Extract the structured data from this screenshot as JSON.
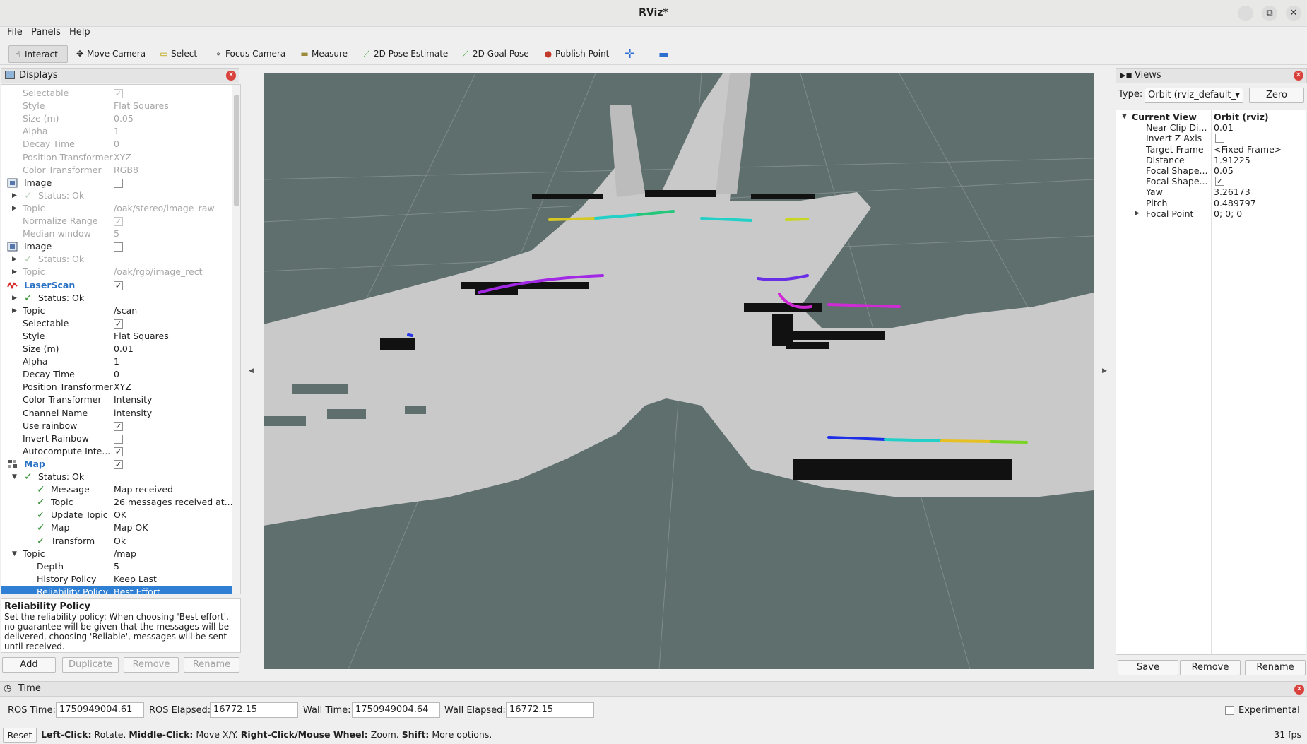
{
  "window": {
    "title": "RViz*"
  },
  "menu": [
    "File",
    "Panels",
    "Help"
  ],
  "toolbar": {
    "interact": "Interact",
    "move_camera": "Move Camera",
    "select": "Select",
    "focus_camera": "Focus Camera",
    "measure": "Measure",
    "pose_estimate": "2D Pose Estimate",
    "goal_pose": "2D Goal Pose",
    "publish_point": "Publish Point",
    "add_icon": "plus-icon",
    "remove_icon": "minus-icon"
  },
  "displays": {
    "title": "Displays",
    "rows": [
      {
        "label": "Selectable",
        "value": "",
        "checkbox": "on",
        "dim": true
      },
      {
        "label": "Style",
        "value": "Flat Squares",
        "dim": true
      },
      {
        "label": "Size (m)",
        "value": "0.05",
        "dim": true
      },
      {
        "label": "Alpha",
        "value": "1",
        "dim": true
      },
      {
        "label": "Decay Time",
        "value": "0",
        "dim": true
      },
      {
        "label": "Position Transformer",
        "value": "XYZ",
        "dim": true
      },
      {
        "label": "Color Transformer",
        "value": "RGB8",
        "dim": true
      },
      {
        "label": "Image",
        "value": "",
        "checkbox": "off",
        "icon": "image",
        "level": 0
      },
      {
        "label": "Status: Ok",
        "value": "",
        "check": true,
        "arrow": "right",
        "dim": true
      },
      {
        "label": "Topic",
        "value": "/oak/stereo/image_raw",
        "arrow": "right",
        "dim": true
      },
      {
        "label": "Normalize Range",
        "value": "",
        "checkbox": "on",
        "dim": true
      },
      {
        "label": "Median window",
        "value": "5",
        "dim": true
      },
      {
        "label": "Image",
        "value": "",
        "checkbox": "off",
        "icon": "image",
        "level": 0
      },
      {
        "label": "Status: Ok",
        "value": "",
        "check": true,
        "arrow": "right",
        "dim": true
      },
      {
        "label": "Topic",
        "value": "/oak/rgb/image_rect",
        "arrow": "right",
        "dim": true
      },
      {
        "label": "LaserScan",
        "value": "",
        "checkbox": "on",
        "icon": "laser",
        "level": 0,
        "blue": true
      },
      {
        "label": "Status: Ok",
        "value": "",
        "check": true,
        "arrow": "right"
      },
      {
        "label": "Topic",
        "value": "/scan",
        "arrow": "right"
      },
      {
        "label": "Selectable",
        "value": "",
        "checkbox": "on"
      },
      {
        "label": "Style",
        "value": "Flat Squares"
      },
      {
        "label": "Size (m)",
        "value": "0.01"
      },
      {
        "label": "Alpha",
        "value": "1"
      },
      {
        "label": "Decay Time",
        "value": "0"
      },
      {
        "label": "Position Transformer",
        "value": "XYZ"
      },
      {
        "label": "Color Transformer",
        "value": "Intensity"
      },
      {
        "label": "Channel Name",
        "value": "intensity"
      },
      {
        "label": "Use rainbow",
        "value": "",
        "checkbox": "on"
      },
      {
        "label": "Invert Rainbow",
        "value": "",
        "checkbox": "off"
      },
      {
        "label": "Autocompute Inte...",
        "value": "",
        "checkbox": "on"
      },
      {
        "label": "Map",
        "value": "",
        "checkbox": "on",
        "icon": "map",
        "level": 0,
        "blue": true
      },
      {
        "label": "Status: Ok",
        "value": "",
        "check": true,
        "arrow": "down"
      },
      {
        "label": "Message",
        "value": "Map received",
        "check": true,
        "level": 2
      },
      {
        "label": "Topic",
        "value": "26 messages received at...",
        "check": true,
        "level": 2
      },
      {
        "label": "Update Topic",
        "value": "OK",
        "check": true,
        "level": 2
      },
      {
        "label": "Map",
        "value": "Map OK",
        "check": true,
        "level": 2
      },
      {
        "label": "Transform",
        "value": "Ok",
        "check": true,
        "level": 2
      },
      {
        "label": "Topic",
        "value": "/map",
        "arrow": "down"
      },
      {
        "label": "Depth",
        "value": "5",
        "level": 2
      },
      {
        "label": "History Policy",
        "value": "Keep Last",
        "level": 2
      },
      {
        "label": "Reliability Policy",
        "value": "Best Effort",
        "level": 2,
        "selected": true
      }
    ],
    "description_title": "Reliability Policy",
    "description_text": "Set the reliability policy: When choosing 'Best effort', no guarantee will be given that the messages will be delivered, choosing 'Reliable', messages will be sent until received.",
    "buttons": {
      "add": "Add",
      "duplicate": "Duplicate",
      "remove": "Remove",
      "rename": "Rename"
    }
  },
  "views": {
    "title": "Views",
    "type_label": "Type:",
    "type_value": "Orbit (rviz_default_",
    "zero": "Zero",
    "rows": [
      {
        "label": "Current View",
        "value": "Orbit (rviz)",
        "bold": true,
        "arrow": "down"
      },
      {
        "label": "Near Clip Di...",
        "value": "0.01"
      },
      {
        "label": "Invert Z Axis",
        "value": "",
        "checkbox": "off"
      },
      {
        "label": "Target Frame",
        "value": "<Fixed Frame>"
      },
      {
        "label": "Distance",
        "value": "1.91225"
      },
      {
        "label": "Focal Shape...",
        "value": "0.05"
      },
      {
        "label": "Focal Shape...",
        "value": "",
        "checkbox": "on"
      },
      {
        "label": "Yaw",
        "value": "3.26173"
      },
      {
        "label": "Pitch",
        "value": "0.489797"
      },
      {
        "label": "Focal Point",
        "value": "0; 0; 0",
        "arrow": "right"
      }
    ],
    "buttons": {
      "save": "Save",
      "remove": "Remove",
      "rename": "Rename"
    }
  },
  "time": {
    "title": "Time",
    "ros_time_label": "ROS Time:",
    "ros_time": "1750949004.61",
    "ros_elapsed_label": "ROS Elapsed:",
    "ros_elapsed": "16772.15",
    "wall_time_label": "Wall Time:",
    "wall_time": "1750949004.64",
    "wall_elapsed_label": "Wall Elapsed:",
    "wall_elapsed": "16772.15",
    "experimental": "Experimental"
  },
  "status": {
    "reset": "Reset",
    "hint_left": "Left-Click:",
    "hint_left_t": " Rotate. ",
    "hint_middle": "Middle-Click:",
    "hint_middle_t": " Move X/Y. ",
    "hint_right": "Right-Click/Mouse Wheel:",
    "hint_right_t": " Zoom. ",
    "hint_shift": "Shift:",
    "hint_shift_t": " More options.",
    "fps": "31 fps"
  }
}
